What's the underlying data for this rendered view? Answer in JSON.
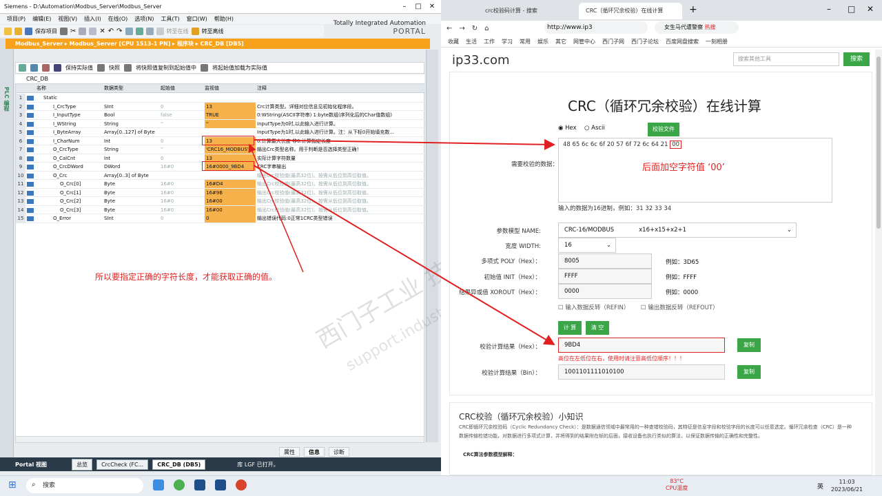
{
  "tia": {
    "title": "Siemens - D:\\Automation\\Modbus_Server\\Modbus_Server",
    "menu": [
      "项目(P)",
      "编辑(E)",
      "视图(V)",
      "插入(I)",
      "在线(O)",
      "选项(N)",
      "工具(T)",
      "窗口(W)",
      "帮助(H)"
    ],
    "brand_line": "Totally Integrated Automation",
    "brand_portal": "PORTAL",
    "toolbar_save": "保存项目",
    "toolbar_online": "转至在线",
    "toolbar_offline": "转至离线",
    "path": "Modbus_Server ▸ Modbus_Server [CPU 1513-1 PN] ▸ 程序块 ▸ CRC_DB [DB5]",
    "side_label": "PLC 编程",
    "db_toolbar": [
      "保持实际值",
      "快照",
      "将快照值复制到起始值中",
      "将起始值加载为实际值"
    ],
    "db_name": "CRC_DB",
    "columns": [
      "名称",
      "数据类型",
      "起始值",
      "监视值",
      "注释"
    ],
    "rows": [
      {
        "n": "1",
        "name": "Static",
        "type": "",
        "start": "",
        "mon": "",
        "comment": ""
      },
      {
        "n": "2",
        "name": "I_CrcType",
        "type": "SInt",
        "start": "0",
        "mon": "13",
        "comment": "Crc计算类型。详细对应信息见初始化程序段。"
      },
      {
        "n": "3",
        "name": "I_InputType",
        "type": "Bool",
        "start": "false",
        "mon": "TRUE",
        "comment": "0:WString(ASCII字符串) 1:byte数组(序列化后的Char值数组)"
      },
      {
        "n": "4",
        "name": "I_WString",
        "type": "String",
        "start": "''",
        "mon": "''",
        "comment": "InputType为0时,以此输入进行计算。"
      },
      {
        "n": "5",
        "name": "I_ByteArray",
        "type": "Array[0..127] of Byte",
        "start": "",
        "mon": "",
        "comment": "InputType为1时,以此输入进行计算。注：从下标0开始填充数..."
      },
      {
        "n": "6",
        "name": "I_CharNum",
        "type": "Int",
        "start": "0",
        "mon": "13",
        "comment": "0:计算最大长度 非0:计算指定长度"
      },
      {
        "n": "7",
        "name": "O_CrcType",
        "type": "String",
        "start": "''",
        "mon": "'CRC16_MODBUS'",
        "comment": "输出Crc类型名称。用于判断是否选择类型正确！"
      },
      {
        "n": "8",
        "name": "O_CalCnt",
        "type": "Int",
        "start": "0",
        "mon": "13",
        "comment": "实际计算字符数量"
      },
      {
        "n": "9",
        "name": "O_CrcDWord",
        "type": "DWord",
        "start": "16#0",
        "mon": "16#0000_9BD4",
        "comment": "CRC字串输出"
      },
      {
        "n": "10",
        "name": "O_Crc",
        "type": "Array[0..3] of Byte",
        "start": "",
        "mon": "",
        "comment": "输出Crc校验值(最高32位)。按需从低位到高位取值。"
      },
      {
        "n": "11",
        "name": "O_Crc[0]",
        "type": "Byte",
        "start": "16#0",
        "mon": "16#D4",
        "comment": "输出Crc校验值(最高32位)。按需从低位到高位取值。"
      },
      {
        "n": "12",
        "name": "O_Crc[1]",
        "type": "Byte",
        "start": "16#0",
        "mon": "16#9B",
        "comment": "输出Crc校验值(最高32位)。按需从低位到高位取值。"
      },
      {
        "n": "13",
        "name": "O_Crc[2]",
        "type": "Byte",
        "start": "16#0",
        "mon": "16#00",
        "comment": "输出Crc校验值(最高32位)。按需从低位到高位取值。"
      },
      {
        "n": "14",
        "name": "O_Crc[3]",
        "type": "Byte",
        "start": "16#0",
        "mon": "16#00",
        "comment": "输出Crc校验值(最高32位)。按需从低位到高位取值。"
      },
      {
        "n": "15",
        "name": "O_Error",
        "type": "SInt",
        "start": "0",
        "mon": "0",
        "comment": "输出错误代码:0正常1CRC类型错误"
      }
    ],
    "annotation": "所以要指定正确的字符长度，才能获取正确的值。",
    "bottom_tabs": [
      "属性",
      "信息",
      "诊断"
    ],
    "status_portal": "Portal 视图",
    "status_tabs": [
      "总览",
      "CrcCheck (FC...",
      "CRC_DB (DB5)"
    ],
    "status_msg": "库 LGF 已打开。"
  },
  "browser": {
    "tab1": "crc校验码计算 - 搜索",
    "tab2": "CRC（循环冗余校验）在线计算",
    "url": "http://www.ip3",
    "search_text": "女生马代遭警察",
    "hot": "热搜",
    "bookmarks": [
      "收藏",
      "生活",
      "工作",
      "学习",
      "常用",
      "娱乐",
      "其它",
      "网管中心",
      "西门子网",
      "西门子论坛",
      "百度网盘搜索",
      "一刻相册"
    ],
    "site": "ip33.com",
    "site_search_ph": "搜索其他工具",
    "site_search_btn": "搜索",
    "heading": "CRC（循环冗余校验）在线计算",
    "radio_hex": "Hex",
    "radio_ascii": "Ascii",
    "verify_file": "校验文件",
    "data_label": "需要校验的数据：",
    "data_value": "48 65 6c 6c 6f 20 57 6f 72 6c 64 21",
    "data_suffix": "00",
    "data_note": "后面加空字符值 ‘00’",
    "hint": "输入的数据为16进制，例如：31 32 33 34",
    "model_label": "参数模型 NAME:",
    "model_value": "CRC-16/MODBUS",
    "model_poly": "x16+x15+x2+1",
    "width_label": "宽度 WIDTH:",
    "width_value": "16",
    "poly_label": "多项式 POLY（Hex）：",
    "poly_value": "8005",
    "poly_ex": "例如：3D65",
    "init_label": "初始值 INIT（Hex）：",
    "init_value": "FFFF",
    "init_ex": "例如：FFFF",
    "xor_label": "结果异或值 XOROUT（Hex）：",
    "xor_value": "0000",
    "xor_ex": "例如：0000",
    "refin": "输入数据反转（REFIN）",
    "refout": "输出数据反转（REFOUT）",
    "calc_btn": "计 算",
    "clear_btn": "清 空",
    "result_hex_label": "校验计算结果（Hex）：",
    "result_hex": "9BD4",
    "copy": "复制",
    "warn": "高位在左低位在右，使用时请注意高低位顺序！！！",
    "result_bin_label": "校验计算结果（Bin）：",
    "result_bin": "1001101111010100",
    "info_title": "CRC校验（循环冗余校验）小知识",
    "info_body": "CRC即循环冗余校验码（Cyclic Redundancy Check）：是数据通信领域中最常用的一种查错校验码，其特征是信息字段和校验字段的长度可以任意选定。循环冗余检查（CRC）是一种数据传输检错功能，对数据进行多项式计算，并将得到的结果附在帧的后面，接收设备也执行类似的算法，以保证数据传输的正确性和完整性。",
    "info_sub": "CRC算法参数模型解释："
  },
  "taskbar": {
    "search": "搜索",
    "cpu_temp": "83°C",
    "cpu_label": "CPU温度",
    "lang": "英",
    "time": "11:03",
    "date": "2023/06/21"
  },
  "watermark": "西门子工业 技术论坛",
  "watermark2": "support.industry.siemens.com/cs"
}
